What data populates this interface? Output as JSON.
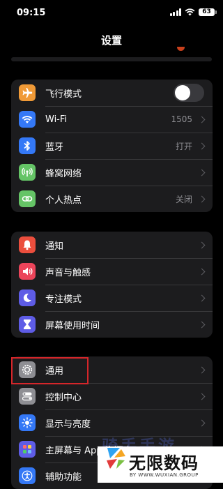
{
  "status_bar": {
    "time": "09:15",
    "battery": "63"
  },
  "nav": {
    "title": "设置"
  },
  "groups": [
    [
      {
        "label": "飞行模式",
        "value": "",
        "icon": "airplane-icon",
        "color": "#f09a37",
        "control": "toggle-off"
      },
      {
        "label": "Wi-Fi",
        "value": "1505",
        "icon": "wifi-icon",
        "color": "#3478f6",
        "control": "chevron"
      },
      {
        "label": "蓝牙",
        "value": "打开",
        "icon": "bluetooth-icon",
        "color": "#3478f6",
        "control": "chevron"
      },
      {
        "label": "蜂窝网络",
        "value": "",
        "icon": "cellular-antenna-icon",
        "color": "#65c466",
        "control": "chevron"
      },
      {
        "label": "个人热点",
        "value": "关闭",
        "icon": "hotspot-chain-icon",
        "color": "#65c466",
        "control": "chevron"
      }
    ],
    [
      {
        "label": "通知",
        "value": "",
        "icon": "notification-bell-icon",
        "color": "#eb4e3d",
        "control": "chevron"
      },
      {
        "label": "声音与触感",
        "value": "",
        "icon": "speaker-icon",
        "color": "#eb445a",
        "control": "chevron"
      },
      {
        "label": "专注模式",
        "value": "",
        "icon": "moon-icon",
        "color": "#5e5ce6",
        "control": "chevron"
      },
      {
        "label": "屏幕使用时间",
        "value": "",
        "icon": "hourglass-icon",
        "color": "#5e5ce6",
        "control": "chevron"
      }
    ],
    [
      {
        "label": "通用",
        "value": "",
        "icon": "gear-icon",
        "color": "#8e8e93",
        "control": "chevron"
      },
      {
        "label": "控制中心",
        "value": "",
        "icon": "switches-icon",
        "color": "#8e8e93",
        "control": "chevron"
      },
      {
        "label": "显示与亮度",
        "value": "",
        "icon": "sun-icon",
        "color": "#3478f6",
        "control": "chevron"
      },
      {
        "label": "主屏幕与 App 资源库",
        "value": "",
        "icon": "app-grid-icon",
        "color": "#5e5ce6",
        "control": "chevron"
      },
      {
        "label": "辅助功能",
        "value": "",
        "icon": "accessibility-icon",
        "color": "#3478f6",
        "control": "chevron"
      }
    ]
  ],
  "watermark": {
    "faded_text": "骑手手游",
    "title": "无限数码",
    "subtitle": "BY WWW.WUXIAN.GROUP"
  }
}
